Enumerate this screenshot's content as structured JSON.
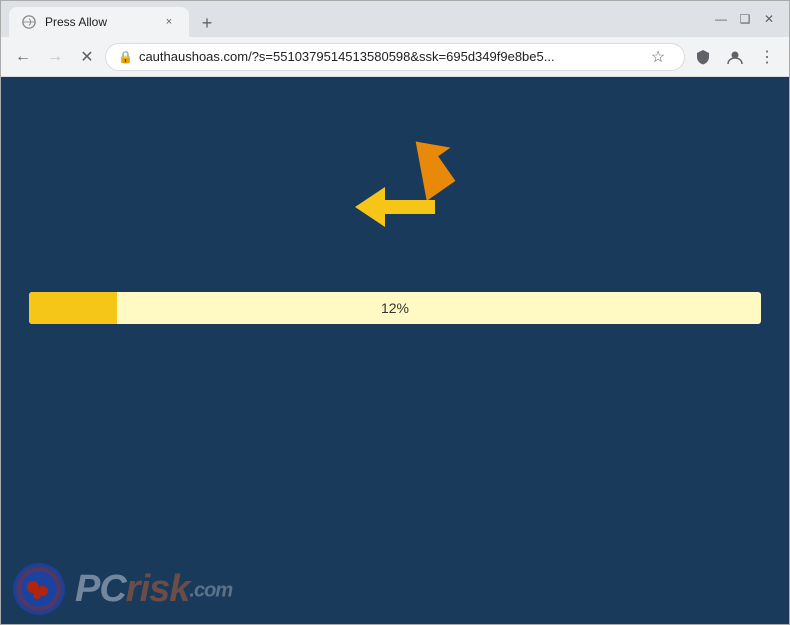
{
  "browser": {
    "title": "Press Allow",
    "tab": {
      "title": "Press Allow",
      "close_label": "×"
    },
    "new_tab_label": "+",
    "window_controls": {
      "minimize": "—",
      "maximize": "❑",
      "close": "✕"
    },
    "toolbar": {
      "back_label": "←",
      "forward_label": "→",
      "reload_label": "✕",
      "url": "cauthaushoas.com/?s=5510379514513580598&ssk=695d349f9e8be5...",
      "star_label": "☆",
      "shield_label": "🛡",
      "profile_label": "👤",
      "menu_label": "⋮"
    }
  },
  "page": {
    "progress": {
      "value": 12,
      "label": "12%",
      "fill_percent": "12%"
    },
    "watermark": {
      "pc_text": "PC",
      "risk_text": "risk",
      "com_text": ".com"
    }
  }
}
